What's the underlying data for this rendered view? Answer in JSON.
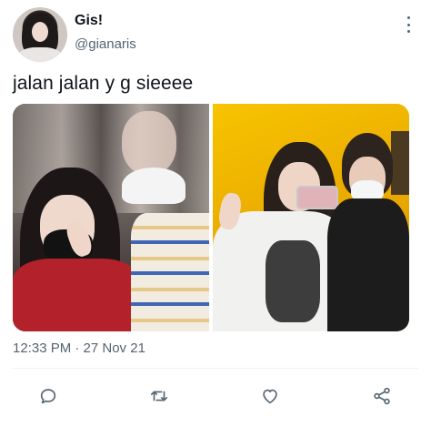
{
  "tweet": {
    "author": {
      "display_name": "Gis!",
      "handle": "@gianaris"
    },
    "text": "jalan jalan y g sieeee",
    "timestamp": "12:33 PM · 27 Nov 21",
    "icons": {
      "more": "more-vertical-icon",
      "reply": "reply-icon",
      "retweet": "retweet-icon",
      "like": "heart-icon",
      "share": "share-icon"
    },
    "colors": {
      "text_primary": "#0f1419",
      "text_secondary": "#536471",
      "divider": "#eff3f4",
      "icon": "#536471"
    }
  }
}
